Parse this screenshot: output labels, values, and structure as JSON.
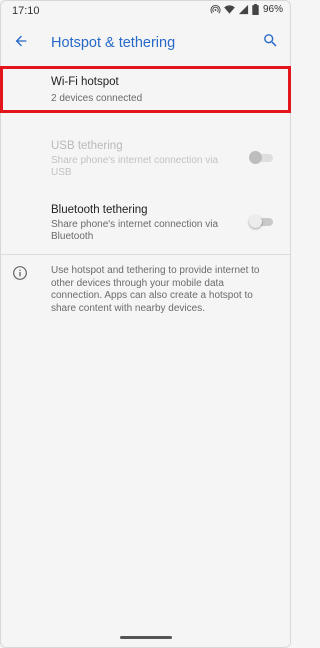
{
  "status_bar": {
    "time": "17:10",
    "battery": "96%",
    "icons": [
      "hotspot-icon",
      "wifi-icon",
      "signal-icon",
      "battery-icon"
    ]
  },
  "app_bar": {
    "title": "Hotspot & tethering",
    "back_icon": "arrow-back-icon",
    "search_icon": "search-icon"
  },
  "items": [
    {
      "title": "Wi-Fi hotspot",
      "subtitle": "2 devices connected",
      "enabled": true,
      "highlighted": true
    },
    {
      "title": "USB tethering",
      "subtitle": "Share phone's internet connection via USB",
      "enabled": false,
      "toggle_on": false
    },
    {
      "title": "Bluetooth tethering",
      "subtitle": "Share phone's internet connection via Bluetooth",
      "enabled": true,
      "toggle_on": false
    }
  ],
  "info": {
    "icon": "info-icon",
    "text": "Use hotspot and tethering to provide internet to other devices through your mobile data connection. Apps can also create a hotspot to share content with nearby devices."
  },
  "colors": {
    "accent": "#2769c9",
    "highlight_border": "#e3141b",
    "background": "#f5f5f5"
  }
}
